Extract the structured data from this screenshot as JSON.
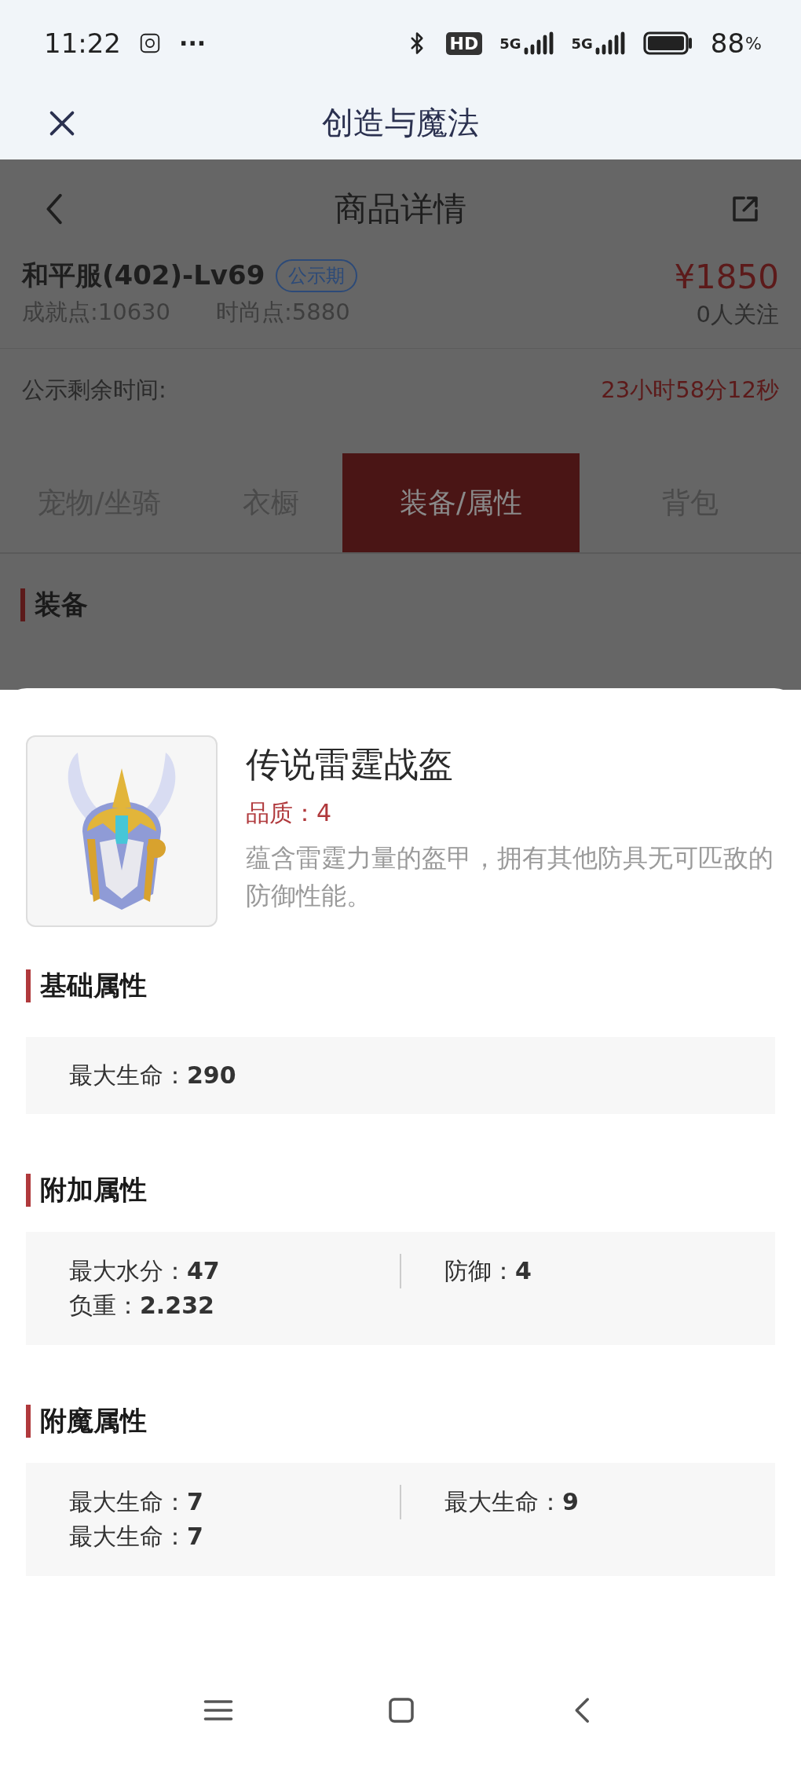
{
  "status_bar": {
    "time": "11:22",
    "more": "···",
    "hd": "HD",
    "network_1": "5G",
    "network_2": "5G",
    "battery": "88",
    "battery_unit": "%"
  },
  "app_bar": {
    "title": "创造与魔法"
  },
  "page": {
    "title": "商品详情",
    "product": {
      "name": "和平服(402)-Lv69",
      "badge": "公示期",
      "price": "¥1850",
      "achievement": "成就点:10630",
      "fashion": "时尚点:5880",
      "followers": "0人关注"
    },
    "countdown": {
      "label": "公示剩余时间:",
      "value": "23小时58分12秒"
    },
    "tabs": [
      {
        "label": "宠物/坐骑",
        "selected": false
      },
      {
        "label": "衣橱",
        "selected": false
      },
      {
        "label": "装备/属性",
        "selected": true
      },
      {
        "label": "背包",
        "selected": false
      }
    ],
    "section_title": "装备"
  },
  "sheet": {
    "item": {
      "name": "传说雷霆战盔",
      "quality": "品质：4",
      "description": "蕴含雷霆力量的盔甲，拥有其他防具无可匹敌的防御性能。"
    },
    "sections": [
      {
        "title": "基础属性",
        "columns": [
          [
            {
              "label": "最大生命：",
              "value": "290"
            }
          ]
        ]
      },
      {
        "title": "附加属性",
        "columns": [
          [
            {
              "label": "最大水分：",
              "value": "47"
            },
            {
              "label": "负重：",
              "value": "2.232"
            }
          ],
          [
            {
              "label": "防御：",
              "value": "4"
            }
          ]
        ]
      },
      {
        "title": "附魔属性",
        "columns": [
          [
            {
              "label": "最大生命：",
              "value": "7"
            },
            {
              "label": "最大生命：",
              "value": "7"
            }
          ],
          [
            {
              "label": "最大生命：",
              "value": "9"
            }
          ]
        ]
      }
    ]
  }
}
